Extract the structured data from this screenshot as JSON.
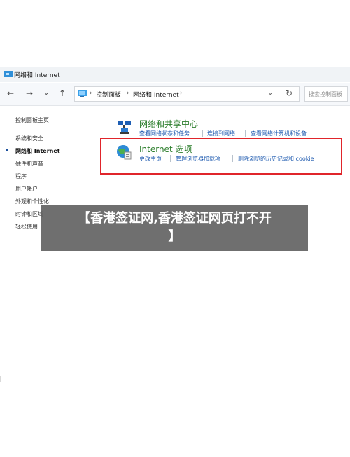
{
  "window": {
    "title": "网络和 Internet"
  },
  "nav": {
    "back": "←",
    "forward": "→",
    "recent": "⌄",
    "up": "↑",
    "breadcrumbs": [
      "控制面板",
      "网络和 Internet"
    ],
    "separator": "›",
    "dropdown": "⌄",
    "refresh": "↻",
    "search_placeholder": "搜索控制面板"
  },
  "sidebar": {
    "items": [
      {
        "label": "控制面板主页",
        "active": false
      },
      {
        "label": "系统和安全",
        "active": false
      },
      {
        "label": "网络和 Internet",
        "active": true
      },
      {
        "label": "硬件和声音",
        "active": false
      },
      {
        "label": "程序",
        "active": false
      },
      {
        "label": "用户帐户",
        "active": false
      },
      {
        "label": "外观和个性化",
        "active": false
      },
      {
        "label": "时钟和区域",
        "active": false
      },
      {
        "label": "轻松使用",
        "active": false
      }
    ]
  },
  "categories": [
    {
      "title": "网络和共享中心",
      "icon": "network-sharing-icon",
      "links": [
        "查看网络状态和任务",
        "连接到网络",
        "查看网络计算机和设备"
      ]
    },
    {
      "title": "Internet 选项",
      "icon": "internet-options-globe-icon",
      "links": [
        "更改主页",
        "管理浏览器加载项",
        "删除浏览的历史记录和 cookie"
      ]
    }
  ],
  "banner": {
    "line1": "【香港签证网,香港签证网页打不开",
    "line2": "】"
  },
  "colors": {
    "highlight": "#e0252b",
    "link": "#1f5bb0",
    "category_title": "#2b7d2b",
    "banner_bg": "#5f5f5f"
  }
}
